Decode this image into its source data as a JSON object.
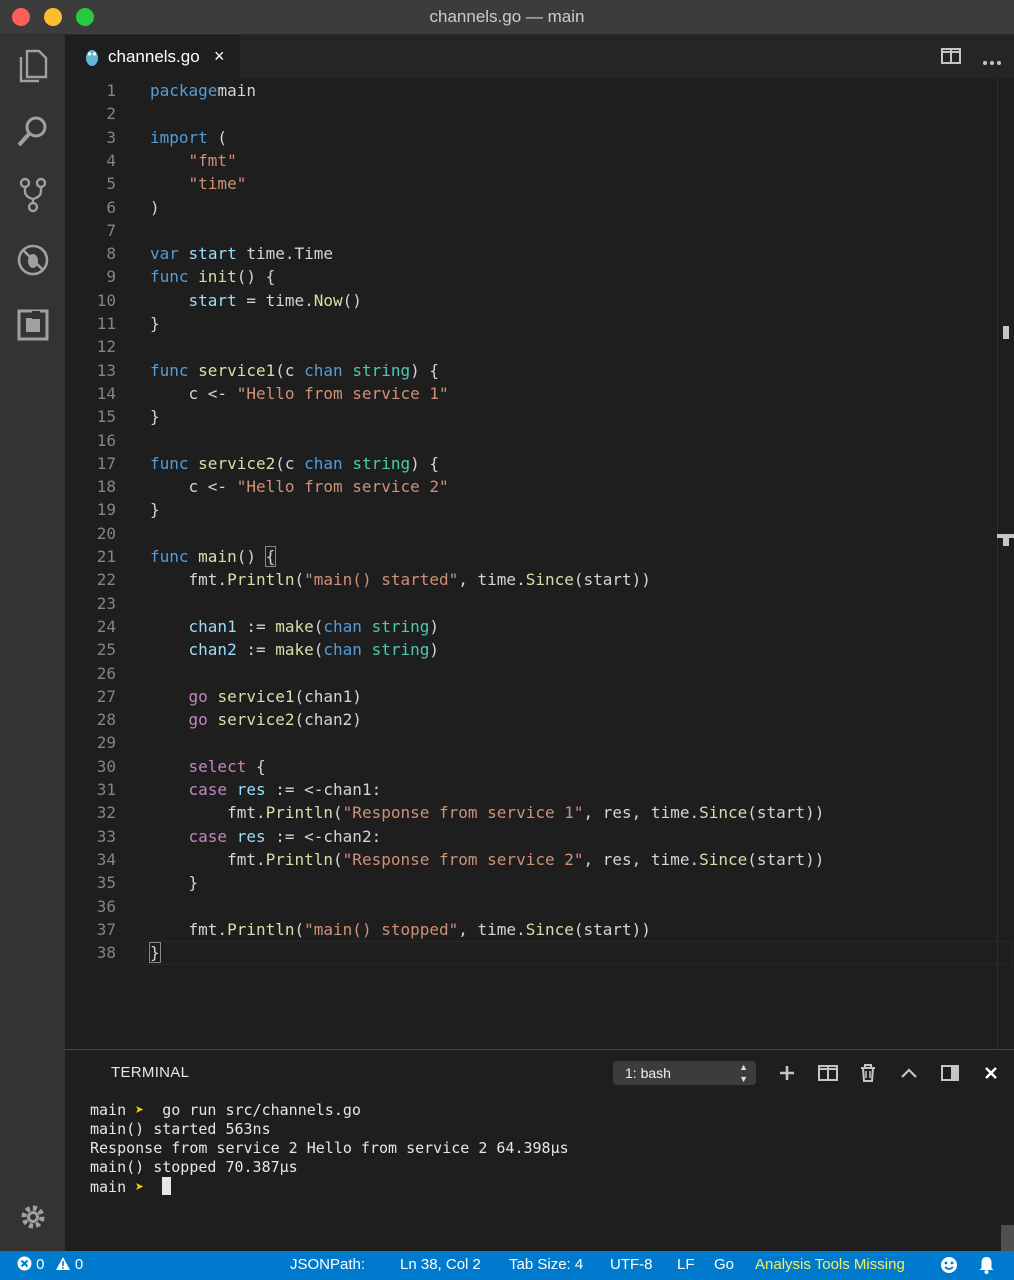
{
  "window": {
    "title": "channels.go — main"
  },
  "activity_bar": {
    "icons": [
      "explorer-icon",
      "search-icon",
      "source-control-icon",
      "debug-icon",
      "extensions-icon",
      "gear-icon"
    ]
  },
  "tab": {
    "label": "channels.go",
    "close": "×"
  },
  "editor": {
    "lines": [
      {
        "n": "1",
        "t": [
          [
            "kw",
            "package"
          ],
          [
            "",
            "main"
          ]
        ]
      },
      {
        "n": "2",
        "t": []
      },
      {
        "n": "3",
        "t": [
          [
            "kw",
            "import"
          ],
          [
            "",
            " ("
          ]
        ]
      },
      {
        "n": "4",
        "t": [
          [
            "",
            "    "
          ],
          [
            "str",
            "\"fmt\""
          ]
        ]
      },
      {
        "n": "5",
        "t": [
          [
            "",
            "    "
          ],
          [
            "str",
            "\"time\""
          ]
        ]
      },
      {
        "n": "6",
        "t": [
          [
            "",
            ")"
          ]
        ]
      },
      {
        "n": "7",
        "t": []
      },
      {
        "n": "8",
        "t": [
          [
            "kw",
            "var"
          ],
          [
            "",
            " "
          ],
          [
            "var",
            "start"
          ],
          [
            "",
            " time.Time"
          ]
        ]
      },
      {
        "n": "9",
        "t": [
          [
            "kw",
            "func"
          ],
          [
            "",
            " "
          ],
          [
            "fn",
            "init"
          ],
          [
            "",
            "() {"
          ]
        ]
      },
      {
        "n": "10",
        "t": [
          [
            "",
            "    "
          ],
          [
            "var",
            "start"
          ],
          [
            "",
            " = time."
          ],
          [
            "fn",
            "Now"
          ],
          [
            "",
            "()"
          ]
        ]
      },
      {
        "n": "11",
        "t": [
          [
            "",
            "}"
          ]
        ]
      },
      {
        "n": "12",
        "t": []
      },
      {
        "n": "13",
        "t": [
          [
            "kw",
            "func"
          ],
          [
            "",
            " "
          ],
          [
            "fn",
            "service1"
          ],
          [
            "",
            "(c "
          ],
          [
            "kw",
            "chan"
          ],
          [
            "",
            " "
          ],
          [
            "ty",
            "string"
          ],
          [
            "",
            ") {"
          ]
        ]
      },
      {
        "n": "14",
        "t": [
          [
            "",
            "    c <- "
          ],
          [
            "str",
            "\"Hello from service 1\""
          ]
        ]
      },
      {
        "n": "15",
        "t": [
          [
            "",
            "}"
          ]
        ]
      },
      {
        "n": "16",
        "t": []
      },
      {
        "n": "17",
        "t": [
          [
            "kw",
            "func"
          ],
          [
            "",
            " "
          ],
          [
            "fn",
            "service2"
          ],
          [
            "",
            "(c "
          ],
          [
            "kw",
            "chan"
          ],
          [
            "",
            " "
          ],
          [
            "ty",
            "string"
          ],
          [
            "",
            ") {"
          ]
        ]
      },
      {
        "n": "18",
        "t": [
          [
            "",
            "    c <- "
          ],
          [
            "str",
            "\"Hello from service 2\""
          ]
        ]
      },
      {
        "n": "19",
        "t": [
          [
            "",
            "}"
          ]
        ]
      },
      {
        "n": "20",
        "t": []
      },
      {
        "n": "21",
        "t": [
          [
            "kw",
            "func"
          ],
          [
            "",
            " "
          ],
          [
            "fn",
            "main"
          ],
          [
            "",
            "() "
          ],
          [
            "brk",
            "{"
          ]
        ]
      },
      {
        "n": "22",
        "t": [
          [
            "",
            "    fmt."
          ],
          [
            "fn",
            "Println"
          ],
          [
            "",
            "("
          ],
          [
            "str",
            "\"main() started\""
          ],
          [
            "",
            ", time."
          ],
          [
            "fn",
            "Since"
          ],
          [
            "",
            "(start))"
          ]
        ]
      },
      {
        "n": "23",
        "t": []
      },
      {
        "n": "24",
        "t": [
          [
            "",
            "    "
          ],
          [
            "var",
            "chan1"
          ],
          [
            "",
            " := "
          ],
          [
            "fn",
            "make"
          ],
          [
            "",
            "("
          ],
          [
            "kw",
            "chan"
          ],
          [
            "",
            " "
          ],
          [
            "ty",
            "string"
          ],
          [
            "",
            ")"
          ]
        ]
      },
      {
        "n": "25",
        "t": [
          [
            "",
            "    "
          ],
          [
            "var",
            "chan2"
          ],
          [
            "",
            " := "
          ],
          [
            "fn",
            "make"
          ],
          [
            "",
            "("
          ],
          [
            "kw",
            "chan"
          ],
          [
            "",
            " "
          ],
          [
            "ty",
            "string"
          ],
          [
            "",
            ")"
          ]
        ]
      },
      {
        "n": "26",
        "t": []
      },
      {
        "n": "27",
        "t": [
          [
            "",
            "    "
          ],
          [
            "ctl",
            "go"
          ],
          [
            "",
            " "
          ],
          [
            "fn",
            "service1"
          ],
          [
            "",
            "(chan1)"
          ]
        ]
      },
      {
        "n": "28",
        "t": [
          [
            "",
            "    "
          ],
          [
            "ctl",
            "go"
          ],
          [
            "",
            " "
          ],
          [
            "fn",
            "service2"
          ],
          [
            "",
            "(chan2)"
          ]
        ]
      },
      {
        "n": "29",
        "t": []
      },
      {
        "n": "30",
        "t": [
          [
            "",
            "    "
          ],
          [
            "ctl",
            "select"
          ],
          [
            "",
            " {"
          ]
        ]
      },
      {
        "n": "31",
        "t": [
          [
            "",
            "    "
          ],
          [
            "ctl",
            "case"
          ],
          [
            "",
            " "
          ],
          [
            "var",
            "res"
          ],
          [
            "",
            " := <-chan1:"
          ]
        ]
      },
      {
        "n": "32",
        "t": [
          [
            "",
            "        fmt."
          ],
          [
            "fn",
            "Println"
          ],
          [
            "",
            "("
          ],
          [
            "str",
            "\"Response from service 1\""
          ],
          [
            "",
            ", res, time."
          ],
          [
            "fn",
            "Since"
          ],
          [
            "",
            "(start))"
          ]
        ]
      },
      {
        "n": "33",
        "t": [
          [
            "",
            "    "
          ],
          [
            "ctl",
            "case"
          ],
          [
            "",
            " "
          ],
          [
            "var",
            "res"
          ],
          [
            "",
            " := <-chan2:"
          ]
        ]
      },
      {
        "n": "34",
        "t": [
          [
            "",
            "        fmt."
          ],
          [
            "fn",
            "Println"
          ],
          [
            "",
            "("
          ],
          [
            "str",
            "\"Response from service 2\""
          ],
          [
            "",
            ", res, time."
          ],
          [
            "fn",
            "Since"
          ],
          [
            "",
            "(start))"
          ]
        ]
      },
      {
        "n": "35",
        "t": [
          [
            "",
            "    }"
          ]
        ]
      },
      {
        "n": "36",
        "t": []
      },
      {
        "n": "37",
        "t": [
          [
            "",
            "    fmt."
          ],
          [
            "fn",
            "Println"
          ],
          [
            "",
            "("
          ],
          [
            "str",
            "\"main() stopped\""
          ],
          [
            "",
            ", time."
          ],
          [
            "fn",
            "Since"
          ],
          [
            "",
            "(start))"
          ]
        ]
      },
      {
        "n": "38",
        "t": [
          [
            "brk",
            "}"
          ]
        ]
      }
    ]
  },
  "panel": {
    "title": "TERMINAL",
    "shell_select": "1: bash",
    "terminal_lines": [
      {
        "prompt": "main",
        "arrow": "➤",
        "cmd": " go run src/channels.go"
      },
      {
        "text": "main() started 563ns"
      },
      {
        "text": "Response from service 2 Hello from service 2 64.398µs"
      },
      {
        "text": "main() stopped 70.387µs"
      },
      {
        "prompt": "main",
        "arrow": "➤",
        "cmd": " ",
        "cursor": true
      }
    ]
  },
  "status_bar": {
    "errors": "0",
    "warnings": "0",
    "jsonpath": "JSONPath:",
    "position": "Ln 38, Col 2",
    "tab_size": "Tab Size: 4",
    "encoding": "UTF-8",
    "eol": "LF",
    "language": "Go",
    "analysis": "Analysis Tools Missing"
  }
}
